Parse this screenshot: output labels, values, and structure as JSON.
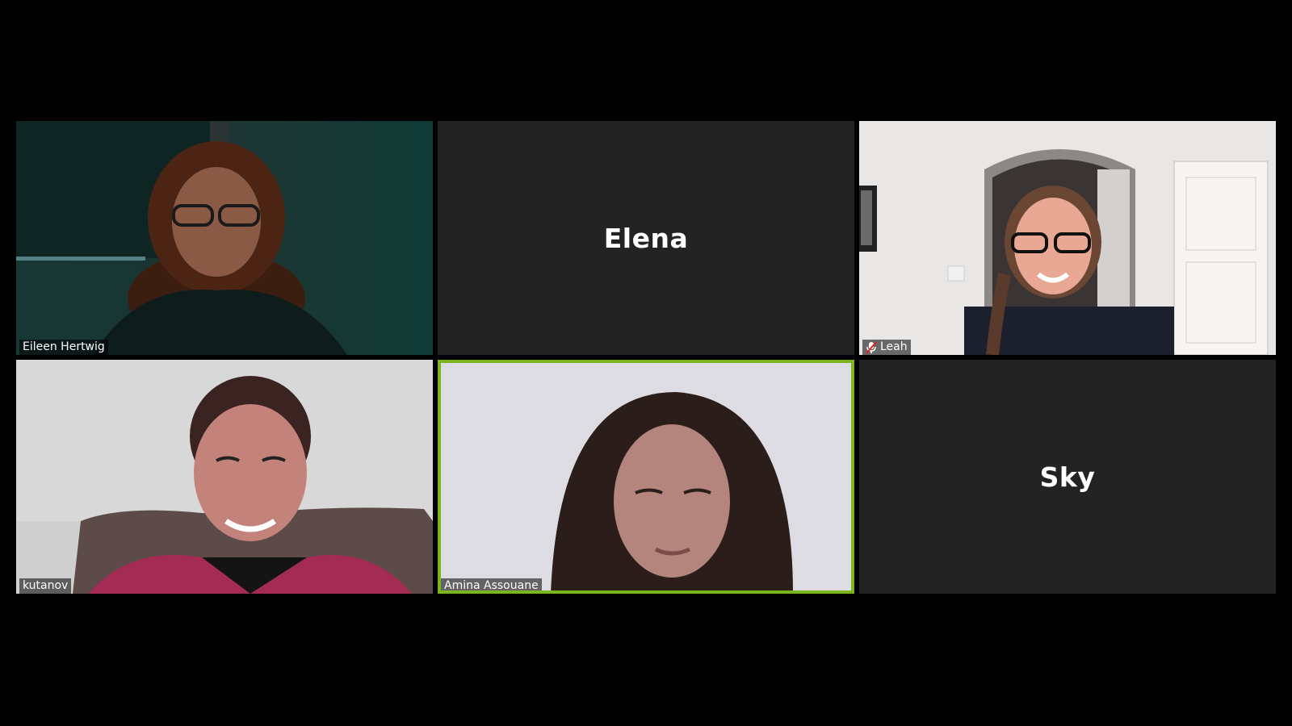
{
  "participants": [
    {
      "name": "Eileen Hertwig",
      "video": true,
      "muted": false,
      "active": false
    },
    {
      "name": "Elena",
      "video": false,
      "muted": false,
      "active": false
    },
    {
      "name": "Leah",
      "video": true,
      "muted": true,
      "active": false
    },
    {
      "name": "kutanov",
      "video": true,
      "muted": false,
      "active": false
    },
    {
      "name": "Amina Assouane",
      "video": true,
      "muted": false,
      "active": true
    },
    {
      "name": "Sky",
      "video": false,
      "muted": false,
      "active": false
    }
  ],
  "colors": {
    "background": "#000000",
    "tile_off": "#232323",
    "active_speaker_border": "#7ab51d",
    "muted_icon": "#e02020"
  },
  "icons": {
    "muted": "mic-muted-icon"
  }
}
